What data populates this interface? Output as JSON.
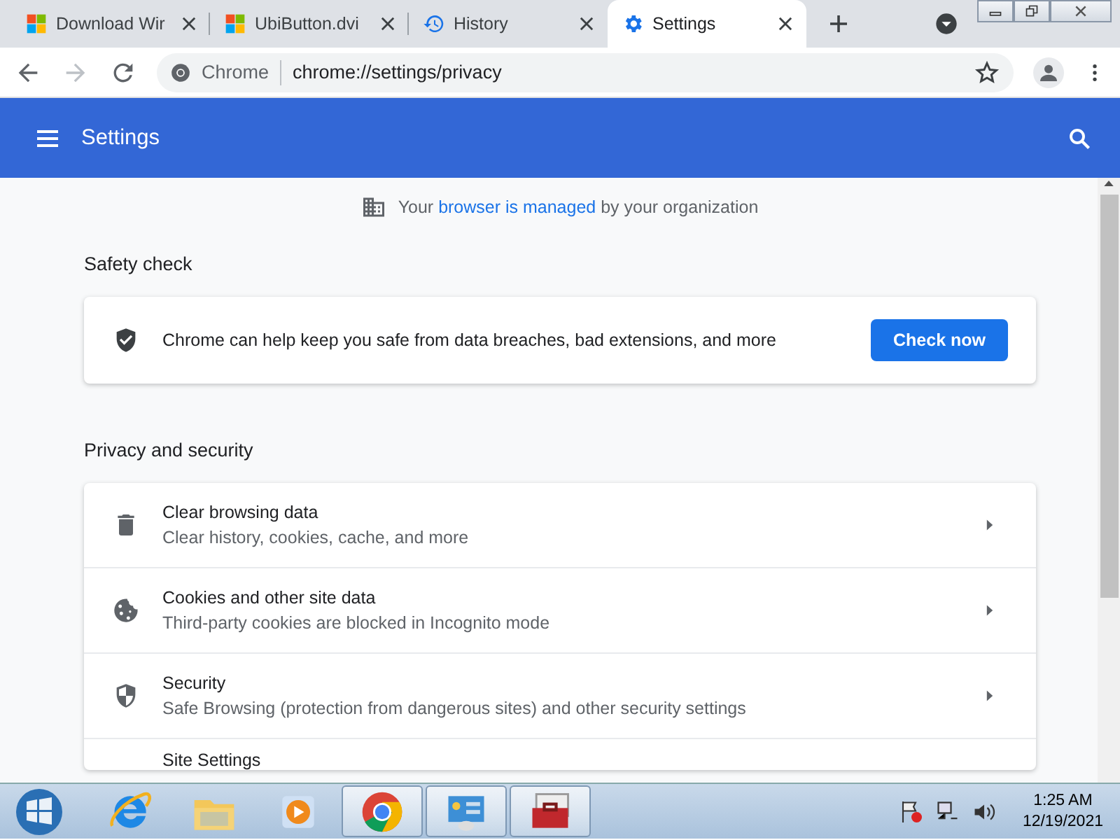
{
  "tabs": [
    {
      "kind": "windows",
      "title": "Download Wir",
      "selected": false
    },
    {
      "kind": "windows",
      "title": "UbiButton.dvi",
      "selected": false
    },
    {
      "kind": "history",
      "title": "History",
      "selected": false
    },
    {
      "kind": "settings",
      "title": "Settings",
      "selected": true
    }
  ],
  "address_bar": {
    "site_label": "Chrome",
    "url": "chrome://settings/privacy"
  },
  "header": {
    "title": "Settings"
  },
  "managed_notice": {
    "before": "Your ",
    "link": "browser is managed",
    "after": " by your organization"
  },
  "safety_check": {
    "heading": "Safety check",
    "text": "Chrome can help keep you safe from data breaches, bad extensions, and more",
    "button": "Check now"
  },
  "privacy": {
    "heading": "Privacy and security",
    "items": [
      {
        "kind": "trash",
        "title": "Clear browsing data",
        "subtitle": "Clear history, cookies, cache, and more"
      },
      {
        "kind": "cookie",
        "title": "Cookies and other site data",
        "subtitle": "Third-party cookies are blocked in Incognito mode"
      },
      {
        "kind": "shield",
        "title": "Security",
        "subtitle": "Safe Browsing (protection from dangerous sites) and other security settings"
      },
      {
        "kind": "none",
        "title": "Site Settings"
      }
    ]
  },
  "taskbar": {
    "apps": [
      {
        "kind": "ie",
        "running": false
      },
      {
        "kind": "folder",
        "running": false
      },
      {
        "kind": "media",
        "running": false
      },
      {
        "kind": "chrome",
        "running": true
      },
      {
        "kind": "control-panel",
        "running": true
      },
      {
        "kind": "toolbox",
        "running": true
      }
    ],
    "time": "1:25 AM",
    "date": "12/19/2021"
  }
}
